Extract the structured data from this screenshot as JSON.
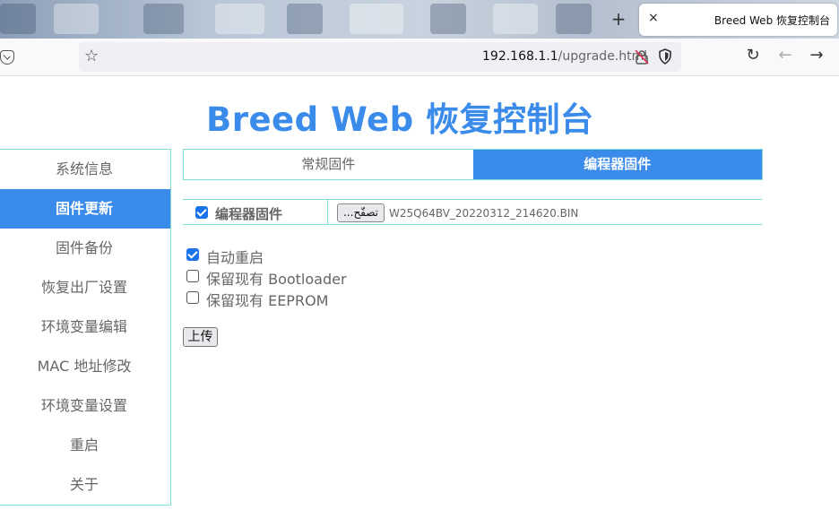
{
  "browser": {
    "tab_title": "Breed Web 恢复控制台",
    "new_tab": "+",
    "close_tab": "×",
    "url_host": "192.168.1.1",
    "url_path": "/upgrade.html",
    "back": "←",
    "forward": "→",
    "reload": "↻"
  },
  "page": {
    "title": "Breed Web 恢复控制台"
  },
  "sidebar": {
    "items": [
      {
        "label": "系统信息",
        "active": false
      },
      {
        "label": "固件更新",
        "active": true
      },
      {
        "label": "固件备份",
        "active": false
      },
      {
        "label": "恢复出厂设置",
        "active": false
      },
      {
        "label": "环境变量编辑",
        "active": false
      },
      {
        "label": "MAC 地址修改",
        "active": false
      },
      {
        "label": "环境变量设置",
        "active": false
      },
      {
        "label": "重启",
        "active": false
      },
      {
        "label": "关于",
        "active": false
      }
    ]
  },
  "tabs": [
    {
      "label": "常规固件",
      "active": false
    },
    {
      "label": "编程器固件",
      "active": true
    }
  ],
  "firmware": {
    "checked": true,
    "label": "编程器固件",
    "browse_label": "...تصفّح",
    "filename": "W25Q64BV_20220312_214620.BIN"
  },
  "options": [
    {
      "label": "自动重启",
      "checked": true
    },
    {
      "label": "保留现有 Bootloader",
      "checked": false
    },
    {
      "label": "保留现有 EEPROM",
      "checked": false
    }
  ],
  "upload_label": "上传",
  "colors": {
    "accent": "#3b8bea",
    "border": "#7fe0d4",
    "checkbox": "#1a73e8"
  }
}
